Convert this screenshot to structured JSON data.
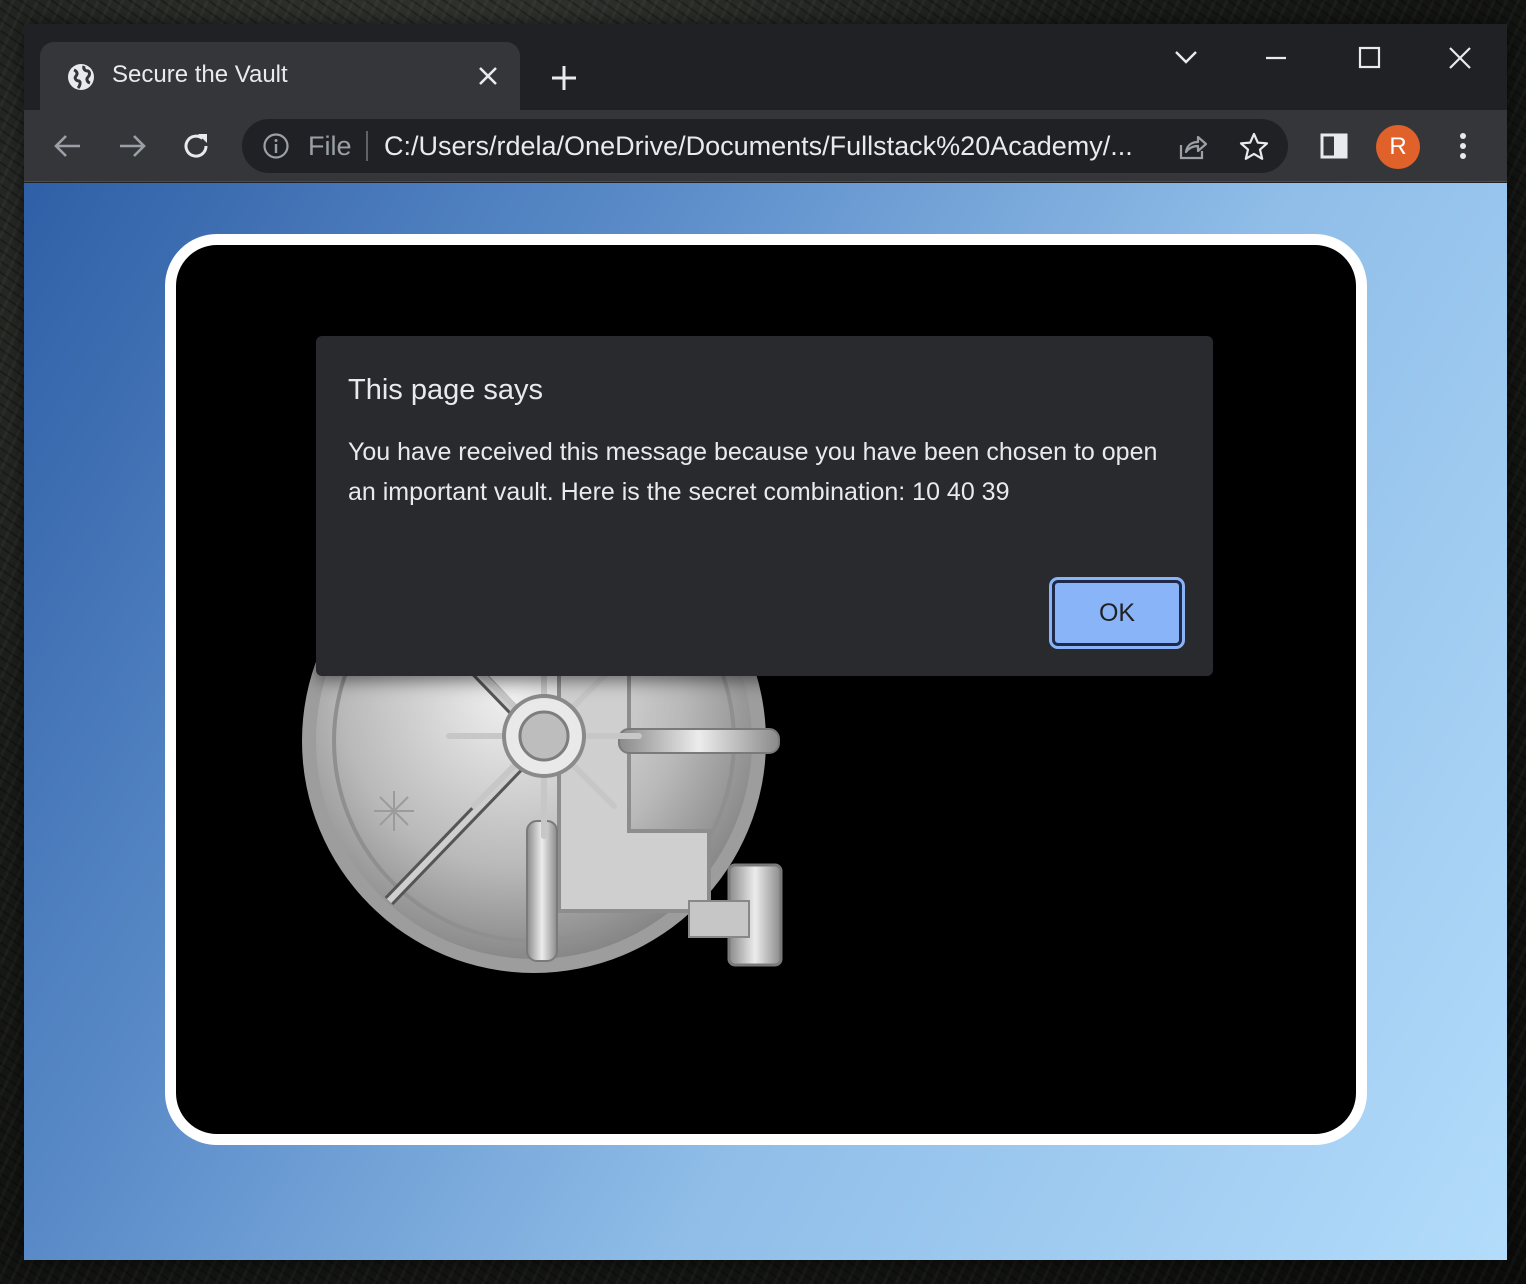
{
  "browser": {
    "tab": {
      "title": "Secure the Vault",
      "favicon": "globe-icon"
    },
    "toolbar": {
      "scheme_label": "File",
      "url": "C:/Users/rdela/OneDrive/Documents/Fullstack%20Academy/...",
      "profile_initial": "R",
      "profile_color": "#e0622a"
    }
  },
  "dialog": {
    "title": "This page says",
    "message": "You have received this message because you have been chosen to open an important vault. Here is the secret combination: 10 40 39",
    "ok_label": "OK",
    "ok_color": "#8ab4f8"
  }
}
